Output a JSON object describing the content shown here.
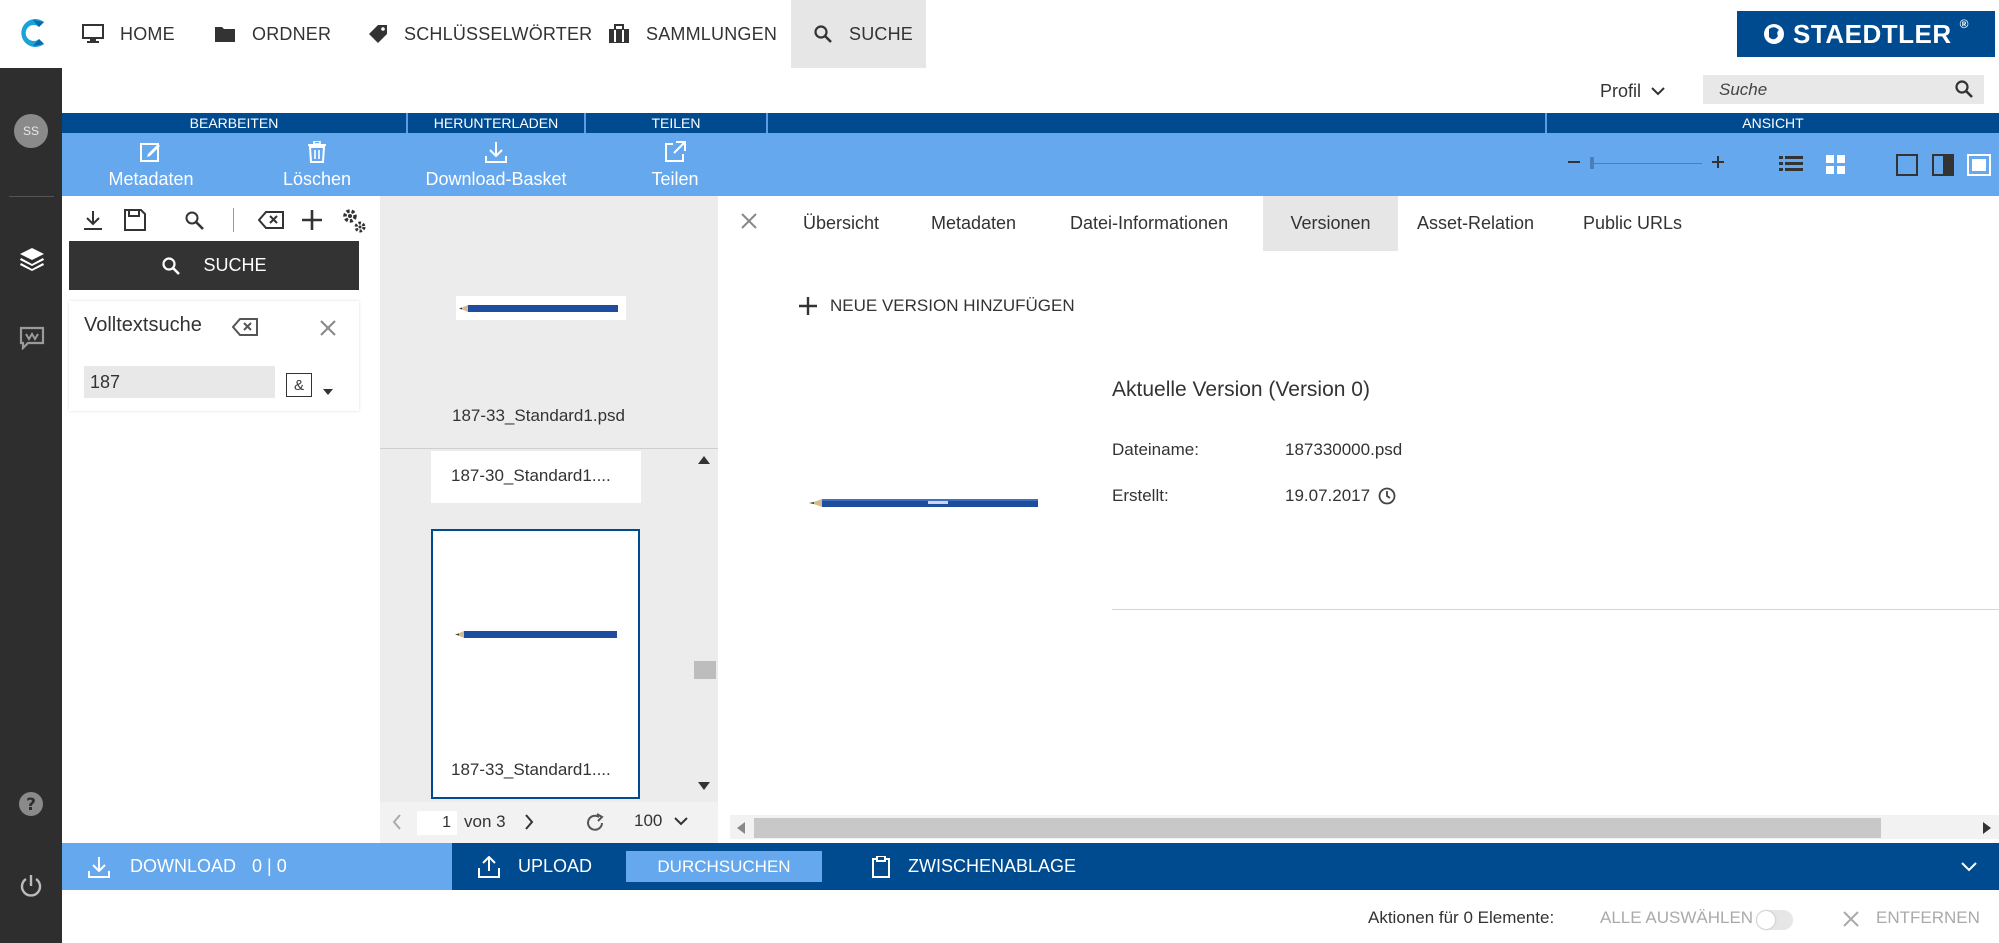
{
  "nav": {
    "items": [
      {
        "label": "HOME",
        "icon": "monitor-icon"
      },
      {
        "label": "ORDNER",
        "icon": "folder-icon"
      },
      {
        "label": "SCHLÜSSELWÖRTER",
        "icon": "tag-icon"
      },
      {
        "label": "SAMMLUNGEN",
        "icon": "briefcase-icon"
      },
      {
        "label": "SUCHE",
        "icon": "search-icon",
        "active": true
      }
    ],
    "brand": "STAEDTLER",
    "brand_mark": "®"
  },
  "sidebar": {
    "avatar_initials": "SS"
  },
  "header": {
    "profile_label": "Profil",
    "search_placeholder": "Suche"
  },
  "sections": [
    "BEARBEITEN",
    "HERUNTERLADEN",
    "TEILEN",
    "ANSICHT"
  ],
  "toolbar": {
    "metadata_label": "Metadaten",
    "delete_label": "Löschen",
    "download_basket_label": "Download-Basket",
    "share_label": "Teilen"
  },
  "search_panel": {
    "search_button": "SUCHE",
    "fulltext_title": "Volltextsuche",
    "fulltext_value": "187",
    "operator": "&"
  },
  "list": {
    "items": [
      {
        "caption": "187-33_Standard1.psd"
      },
      {
        "caption": "187-30_Standard1...."
      },
      {
        "caption": "187-33_Standard1....",
        "selected": true
      }
    ],
    "pager": {
      "page": "1",
      "of_label": "von 3",
      "page_size": "100"
    }
  },
  "detail": {
    "tabs": [
      "Übersicht",
      "Metadaten",
      "Datei-Informationen",
      "Versionen",
      "Asset-Relation",
      "Public URLs"
    ],
    "active_tab": "Versionen",
    "add_version_label": "NEUE VERSION HINZUFÜGEN",
    "version_title": "Aktuelle Version (Version 0)",
    "filename_label": "Dateiname:",
    "filename_value": "187330000.psd",
    "created_label": "Erstellt:",
    "created_value": "19.07.2017"
  },
  "bottom": {
    "download_label": "DOWNLOAD",
    "download_count": "0 | 0",
    "upload_label": "UPLOAD",
    "browse_label": "DURCHSUCHEN",
    "clipboard_label": "ZWISCHENABLAGE"
  },
  "footer": {
    "actions_label": "Aktionen für 0 Elemente:",
    "select_all_label": "ALLE AUSWÄHLEN",
    "remove_label": "ENTFERNEN"
  },
  "colors": {
    "dark_blue": "#004a8f",
    "light_blue": "#65a8ee",
    "sidebar": "#2e2e2e"
  }
}
